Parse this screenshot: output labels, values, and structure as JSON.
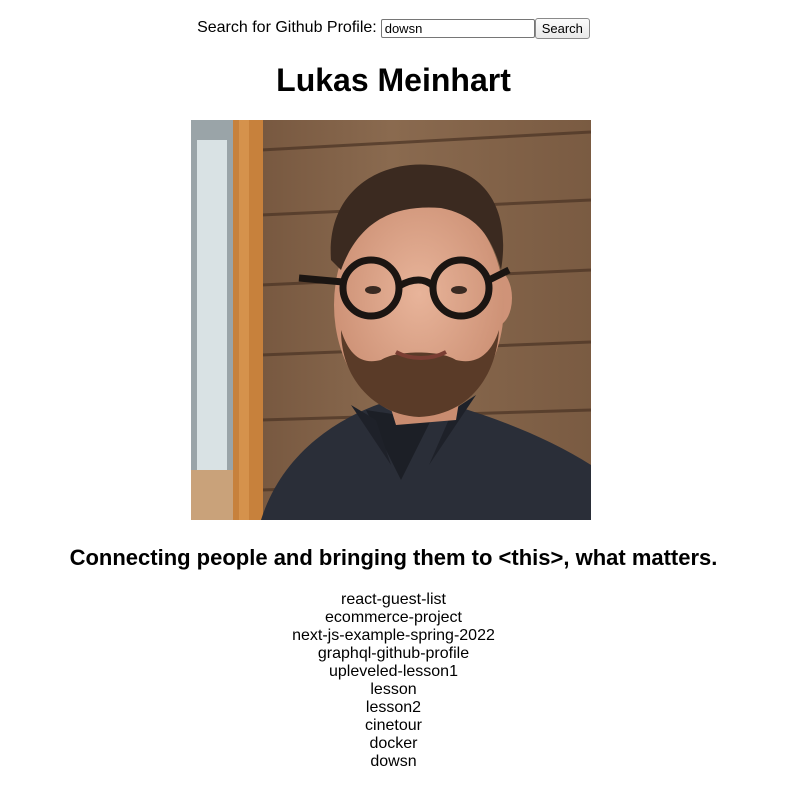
{
  "search": {
    "label": "Search for Github Profile:",
    "value": "dowsn",
    "button_label": "Search"
  },
  "profile": {
    "name": "Lukas Meinhart",
    "bio": "Connecting people and bringing them to <this>, what matters."
  },
  "repositories": [
    "react-guest-list",
    "ecommerce-project",
    "next-js-example-spring-2022",
    "graphql-github-profile",
    "upleveled-lesson1",
    "lesson",
    "lesson2",
    "cinetour",
    "docker",
    "dowsn"
  ]
}
